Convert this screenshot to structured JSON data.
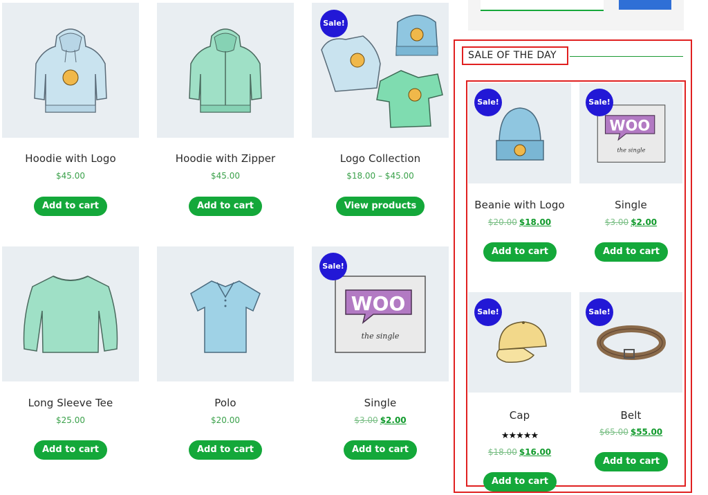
{
  "grid": [
    {
      "title": "Hoodie with Logo",
      "price": "$45.00",
      "button": "Add to cart"
    },
    {
      "title": "Hoodie with Zipper",
      "price": "$45.00",
      "button": "Add to cart"
    },
    {
      "title": "Logo Collection",
      "price": "$18.00 – $45.00",
      "button": "View products",
      "badge": "Sale!"
    },
    {
      "title": "Long Sleeve Tee",
      "price": "$25.00",
      "button": "Add to cart"
    },
    {
      "title": "Polo",
      "price": "$20.00",
      "button": "Add to cart"
    },
    {
      "title": "Single",
      "old_price": "$3.00",
      "new_price": "$2.00",
      "button": "Add to cart",
      "badge": "Sale!"
    }
  ],
  "sidebar": {
    "heading": "SALE OF THE DAY",
    "items": [
      {
        "title": "Beanie with Logo",
        "old_price": "$20.00",
        "new_price": "$18.00",
        "button": "Add to cart",
        "badge": "Sale!"
      },
      {
        "title": "Single",
        "old_price": "$3.00",
        "new_price": "$2.00",
        "button": "Add to cart",
        "badge": "Sale!"
      },
      {
        "title": "Cap",
        "rating": "★★★★★",
        "old_price": "$18.00",
        "new_price": "$16.00",
        "button": "Add to cart",
        "badge": "Sale!"
      },
      {
        "title": "Belt",
        "old_price": "$65.00",
        "new_price": "$55.00",
        "button": "Add to cart",
        "badge": "Sale!"
      }
    ]
  },
  "colors": {
    "accent": "#14a83a",
    "badge": "#2218d6",
    "highlight": "#e02020"
  }
}
